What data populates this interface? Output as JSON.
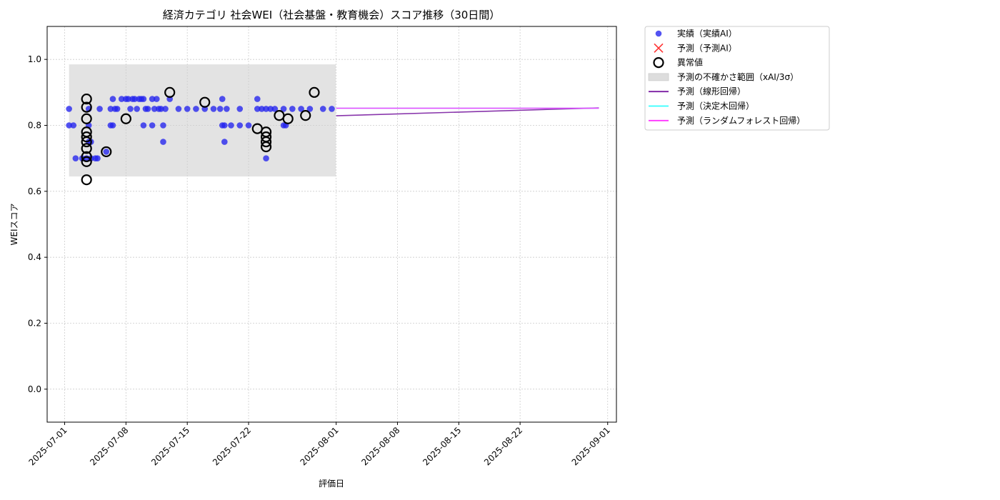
{
  "chart_data": {
    "type": "scatter",
    "title": "経済カテゴリ 社会WEI（社会基盤・教育機会）スコア推移（30日間）",
    "xlabel": "評価日",
    "ylabel": "WEIスコア",
    "xlim": [
      "2025-06-29",
      "2025-09-02"
    ],
    "ylim": [
      -0.1,
      1.1
    ],
    "x_ticks": [
      "2025-07-01",
      "2025-07-08",
      "2025-07-15",
      "2025-07-22",
      "2025-08-01",
      "2025-08-08",
      "2025-08-15",
      "2025-08-22",
      "2025-09-01"
    ],
    "y_ticks": [
      0.0,
      0.2,
      0.4,
      0.6,
      0.8,
      1.0
    ],
    "y_tick_labels": [
      "0.0",
      "0.2",
      "0.4",
      "0.6",
      "0.8",
      "1.0"
    ],
    "grid": true,
    "legend_position": "outside-right",
    "uncertainty_band": {
      "x_start": "2025-07-01 12:00",
      "x_end": "2025-07-31 23:00",
      "y_low": 0.645,
      "y_high": 0.985,
      "color": "#cccccc"
    },
    "series": [
      {
        "name": "実績（実績AI）",
        "kind": "scatter",
        "color": "#2222ee",
        "points": [
          [
            "2025-07-01 12:00",
            0.85
          ],
          [
            "2025-07-01 12:00",
            0.8
          ],
          [
            "2025-07-02 00:00",
            0.8
          ],
          [
            "2025-07-02 06:00",
            0.7
          ],
          [
            "2025-07-03 00:00",
            0.7
          ],
          [
            "2025-07-03 12:00",
            0.7
          ],
          [
            "2025-07-03 18:00",
            0.75
          ],
          [
            "2025-07-03 18:00",
            0.8
          ],
          [
            "2025-07-03 18:00",
            0.85
          ],
          [
            "2025-07-04 00:00",
            0.75
          ],
          [
            "2025-07-04 00:00",
            0.7
          ],
          [
            "2025-07-04 12:00",
            0.7
          ],
          [
            "2025-07-04 18:00",
            0.7
          ],
          [
            "2025-07-05 00:00",
            0.85
          ],
          [
            "2025-07-05 18:00",
            0.72
          ],
          [
            "2025-07-06 06:00",
            0.85
          ],
          [
            "2025-07-06 06:00",
            0.8
          ],
          [
            "2025-07-06 12:00",
            0.88
          ],
          [
            "2025-07-06 12:00",
            0.8
          ],
          [
            "2025-07-06 18:00",
            0.85
          ],
          [
            "2025-07-07 00:00",
            0.85
          ],
          [
            "2025-07-07 12:00",
            0.88
          ],
          [
            "2025-07-08 00:00",
            0.88
          ],
          [
            "2025-07-08 06:00",
            0.88
          ],
          [
            "2025-07-08 12:00",
            0.85
          ],
          [
            "2025-07-08 18:00",
            0.88
          ],
          [
            "2025-07-09 00:00",
            0.88
          ],
          [
            "2025-07-09 06:00",
            0.85
          ],
          [
            "2025-07-09 12:00",
            0.88
          ],
          [
            "2025-07-09 18:00",
            0.88
          ],
          [
            "2025-07-10 00:00",
            0.88
          ],
          [
            "2025-07-10 00:00",
            0.8
          ],
          [
            "2025-07-10 06:00",
            0.85
          ],
          [
            "2025-07-10 12:00",
            0.85
          ],
          [
            "2025-07-11 00:00",
            0.88
          ],
          [
            "2025-07-11 00:00",
            0.8
          ],
          [
            "2025-07-11 06:00",
            0.85
          ],
          [
            "2025-07-11 12:00",
            0.88
          ],
          [
            "2025-07-11 18:00",
            0.85
          ],
          [
            "2025-07-12 00:00",
            0.85
          ],
          [
            "2025-07-12 06:00",
            0.8
          ],
          [
            "2025-07-12 06:00",
            0.75
          ],
          [
            "2025-07-12 12:00",
            0.85
          ],
          [
            "2025-07-13 00:00",
            0.88
          ],
          [
            "2025-07-14 00:00",
            0.85
          ],
          [
            "2025-07-15 00:00",
            0.85
          ],
          [
            "2025-07-16 00:00",
            0.85
          ],
          [
            "2025-07-17 00:00",
            0.85
          ],
          [
            "2025-07-18 00:00",
            0.85
          ],
          [
            "2025-07-18 18:00",
            0.85
          ],
          [
            "2025-07-19 00:00",
            0.88
          ],
          [
            "2025-07-19 00:00",
            0.8
          ],
          [
            "2025-07-19 06:00",
            0.75
          ],
          [
            "2025-07-19 06:00",
            0.8
          ],
          [
            "2025-07-19 12:00",
            0.85
          ],
          [
            "2025-07-20 00:00",
            0.8
          ],
          [
            "2025-07-21 00:00",
            0.85
          ],
          [
            "2025-07-21 00:00",
            0.8
          ],
          [
            "2025-07-22 00:00",
            0.8
          ],
          [
            "2025-07-23 00:00",
            0.88
          ],
          [
            "2025-07-23 00:00",
            0.85
          ],
          [
            "2025-07-23 12:00",
            0.85
          ],
          [
            "2025-07-24 00:00",
            0.85
          ],
          [
            "2025-07-24 00:00",
            0.7
          ],
          [
            "2025-07-24 12:00",
            0.85
          ],
          [
            "2025-07-25 00:00",
            0.85
          ],
          [
            "2025-07-26 00:00",
            0.85
          ],
          [
            "2025-07-26 00:00",
            0.8
          ],
          [
            "2025-07-26 06:00",
            0.8
          ],
          [
            "2025-07-27 00:00",
            0.85
          ],
          [
            "2025-07-28 00:00",
            0.85
          ],
          [
            "2025-07-29 00:00",
            0.85
          ],
          [
            "2025-07-30 12:00",
            0.85
          ],
          [
            "2025-07-31 12:00",
            0.85
          ]
        ]
      },
      {
        "name": "予測（予測AI）",
        "kind": "marker-x",
        "color": "#ff3333",
        "points": []
      },
      {
        "name": "異常値",
        "kind": "ring",
        "color": "#000000",
        "points": [
          [
            "2025-07-03 12:00",
            0.88
          ],
          [
            "2025-07-03 12:00",
            0.855
          ],
          [
            "2025-07-03 12:00",
            0.82
          ],
          [
            "2025-07-03 12:00",
            0.78
          ],
          [
            "2025-07-03 12:00",
            0.765
          ],
          [
            "2025-07-03 12:00",
            0.75
          ],
          [
            "2025-07-03 12:00",
            0.73
          ],
          [
            "2025-07-03 12:00",
            0.705
          ],
          [
            "2025-07-03 12:00",
            0.69
          ],
          [
            "2025-07-03 12:00",
            0.635
          ],
          [
            "2025-07-05 18:00",
            0.72
          ],
          [
            "2025-07-08 00:00",
            0.82
          ],
          [
            "2025-07-13 00:00",
            0.9
          ],
          [
            "2025-07-17 00:00",
            0.87
          ],
          [
            "2025-07-23 00:00",
            0.79
          ],
          [
            "2025-07-24 00:00",
            0.78
          ],
          [
            "2025-07-24 00:00",
            0.765
          ],
          [
            "2025-07-24 00:00",
            0.75
          ],
          [
            "2025-07-24 00:00",
            0.735
          ],
          [
            "2025-07-25 12:00",
            0.83
          ],
          [
            "2025-07-26 12:00",
            0.82
          ],
          [
            "2025-07-28 12:00",
            0.83
          ],
          [
            "2025-07-29 12:00",
            0.9
          ]
        ]
      },
      {
        "name": "予測（線形回帰）",
        "kind": "line",
        "color": "#7b1fa2",
        "points": [
          [
            "2025-08-01 00:00",
            0.829
          ],
          [
            "2025-08-31 00:00",
            0.853
          ]
        ]
      },
      {
        "name": "予測（決定木回帰）",
        "kind": "line",
        "color": "#33ffff",
        "points": [
          [
            "2025-08-01 00:00",
            0.852
          ],
          [
            "2025-08-31 00:00",
            0.852
          ]
        ]
      },
      {
        "name": "予測（ランダムフォレスト回帰）",
        "kind": "line",
        "color": "#ff33ff",
        "points": [
          [
            "2025-08-01 00:00",
            0.852
          ],
          [
            "2025-08-31 00:00",
            0.852
          ]
        ]
      }
    ],
    "legend": [
      {
        "label": "実績（実績AI）",
        "symbol": "dot",
        "color": "#2222ee"
      },
      {
        "label": "予測（予測AI）",
        "symbol": "x",
        "color": "#ff3333"
      },
      {
        "label": "異常値",
        "symbol": "ring",
        "color": "#000000"
      },
      {
        "label": "予測の不確かさ範囲（xAI/3σ）",
        "symbol": "band",
        "color": "#dddddd"
      },
      {
        "label": "予測（線形回帰）",
        "symbol": "line",
        "color": "#7b1fa2"
      },
      {
        "label": "予測（決定木回帰）",
        "symbol": "line",
        "color": "#33ffff"
      },
      {
        "label": "予測（ランダムフォレスト回帰）",
        "symbol": "line",
        "color": "#ff33ff"
      }
    ]
  }
}
